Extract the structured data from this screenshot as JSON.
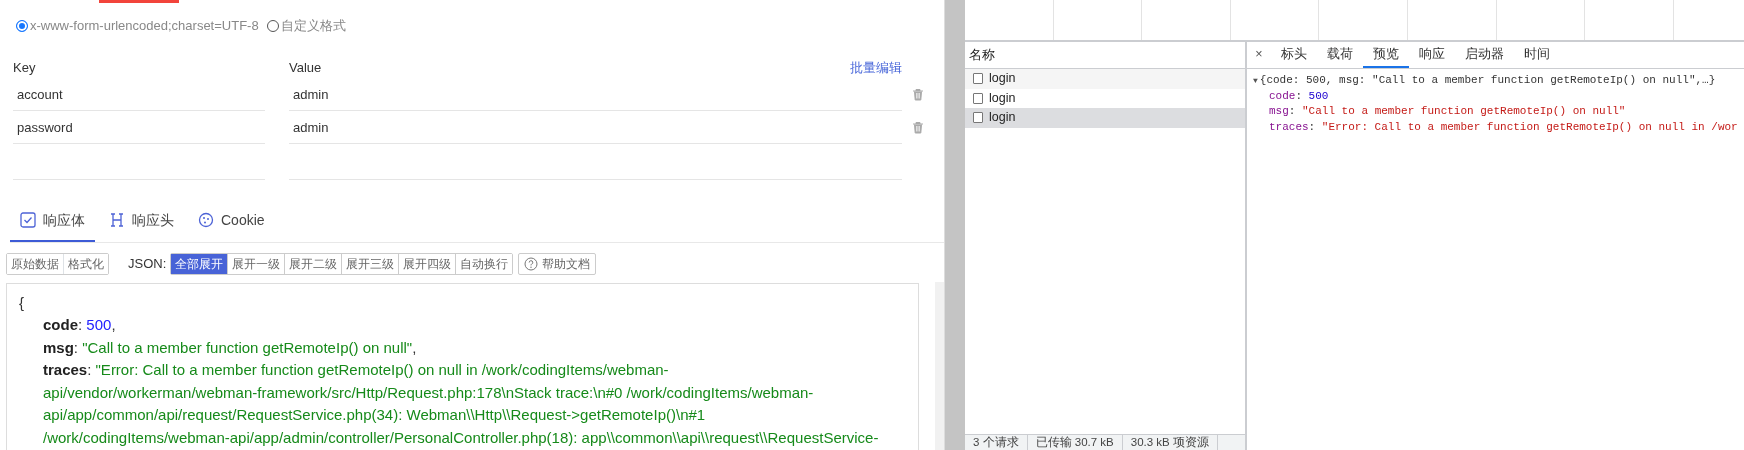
{
  "body_format": {
    "options": [
      {
        "label": "x-www-form-urlencoded;charset=UTF-8",
        "selected": true
      },
      {
        "label": "自定义格式",
        "selected": false
      }
    ]
  },
  "params": {
    "key_header": "Key",
    "value_header": "Value",
    "bulk_edit": "批量编辑",
    "rows": [
      {
        "key": "account",
        "value": "admin"
      },
      {
        "key": "password",
        "value": "admin"
      }
    ]
  },
  "response_tabs": [
    {
      "label": "响应体",
      "kind": "check",
      "selected": true
    },
    {
      "label": "响应头",
      "kind": "header",
      "selected": false
    },
    {
      "label": "Cookie",
      "kind": "cookie",
      "selected": false
    }
  ],
  "view_buttons": [
    "原始数据",
    "格式化"
  ],
  "json_label": "JSON:",
  "expand_buttons": [
    {
      "label": "全部展开",
      "selected": true
    },
    {
      "label": "展开一级",
      "selected": false
    },
    {
      "label": "展开二级",
      "selected": false
    },
    {
      "label": "展开三级",
      "selected": false
    },
    {
      "label": "展开四级",
      "selected": false
    },
    {
      "label": "自动换行",
      "selected": false
    }
  ],
  "help_button": "帮助文档",
  "response_json": {
    "open": "{",
    "fields": [
      {
        "key": "code",
        "sep": ":",
        "kind": "number",
        "lines": [
          "500"
        ],
        "suffix": ","
      },
      {
        "key": "msg",
        "sep": ":",
        "kind": "string",
        "lines": [
          "\"Call to a member function getRemoteIp() on null\""
        ],
        "suffix": ","
      },
      {
        "key": "traces",
        "sep": ":",
        "kind": "string",
        "lines": [
          "\"Error: Call to a member function getRemoteIp() on null in /work/codingItems/webman-",
          "api/vendor/workerman/webman-framework/src/Http/Request.php:178\\nStack trace:\\n#0 /work/codingItems/webman-",
          "api/app/common/api/request/RequestService.php(34): Webman\\\\Http\\\\Request->getRemoteIp()\\n#1",
          "/work/codingItems/webman-api/app/admin/controller/PersonalController.php(18): app\\\\common\\\\api\\\\request\\\\RequestService-"
        ]
      }
    ]
  },
  "network": {
    "name_header": "名称",
    "requests": [
      {
        "name": "login",
        "selected": false
      },
      {
        "name": "login",
        "selected": false
      },
      {
        "name": "login",
        "selected": true
      }
    ]
  },
  "detail_tabs": [
    {
      "label": "标头",
      "selected": false
    },
    {
      "label": "载荷",
      "selected": false
    },
    {
      "label": "预览",
      "selected": true
    },
    {
      "label": "响应",
      "selected": false
    },
    {
      "label": "启动器",
      "selected": false
    },
    {
      "label": "时间",
      "selected": false
    }
  ],
  "close_tab": "×",
  "preview": {
    "toggle": "▼",
    "summary": "{code: 500, msg: \"Call to a member function getRemoteIp() on null\",…}",
    "expanded": true,
    "props": [
      {
        "key": "code",
        "sep": ":",
        "kind": "number",
        "value": "500"
      },
      {
        "key": "msg",
        "sep": ":",
        "kind": "string",
        "value": "\"Call to a member function getRemoteIp() on null\""
      },
      {
        "key": "traces",
        "sep": ":",
        "kind": "string",
        "value": "\"Error: Call to a member function getRemoteIp() on null in /wor"
      }
    ]
  },
  "status_bar": [
    "3 个请求",
    "已传输 30.7 kB",
    "30.3 kB 项资源"
  ]
}
